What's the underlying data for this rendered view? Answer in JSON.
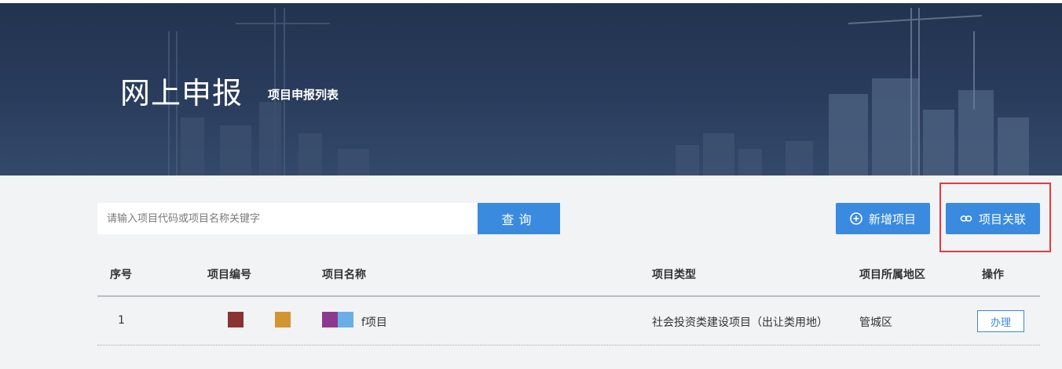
{
  "banner": {
    "title": "网上申报",
    "subtitle": "项目申报列表"
  },
  "toolbar": {
    "search_placeholder": "请输入项目代码或项目名称关键字",
    "search_label": "查询",
    "add_label": "新增项目",
    "add_icon": "plus-circle-icon",
    "link_label": "项目关联",
    "link_icon": "link-icon"
  },
  "table": {
    "columns": [
      "序号",
      "项目编号",
      "项目名称",
      "项目类型",
      "项目所属地区",
      "操作"
    ],
    "rows": [
      {
        "index": "1",
        "code_colors": [
          "#8b3232",
          "#d29532"
        ],
        "name_colors": [
          "#8b3a8f",
          "#6aaee8"
        ],
        "name_suffix": "f项目",
        "type": "社会投资类建设项目（出让类用地）",
        "region": "管城区",
        "action": "办理"
      }
    ]
  },
  "colors": {
    "accent": "#3a8ae0",
    "banner_bg": "#2a3c5c",
    "highlight": "#e23b3b"
  }
}
